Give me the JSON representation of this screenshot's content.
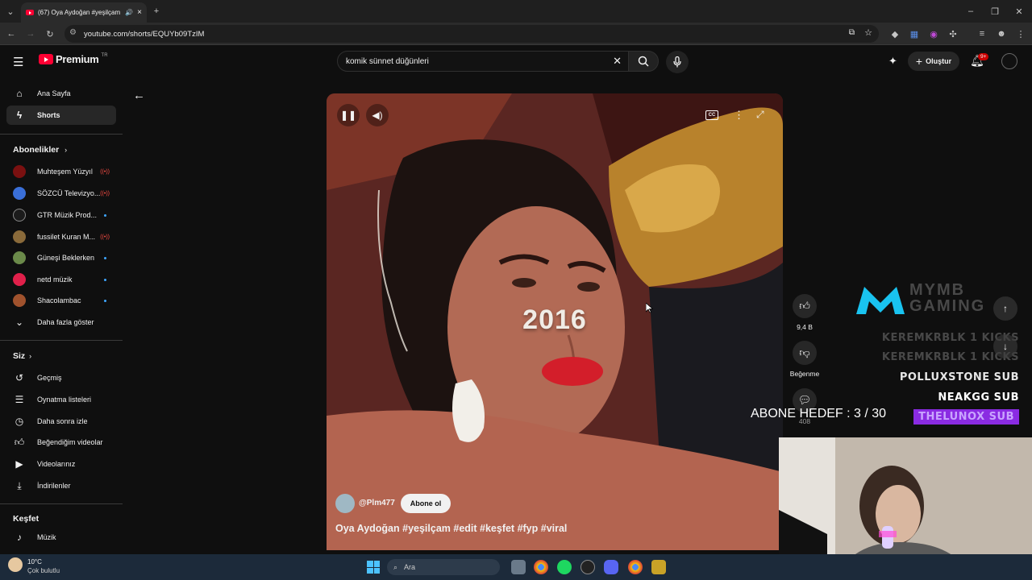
{
  "browser": {
    "tab_title": "(67) Oya Aydoğan #yeşilçam",
    "url": "youtube.com/shorts/EQUYb09TzIM"
  },
  "header": {
    "logo_text": "Premium",
    "region": "TR",
    "search_value": "komik sünnet düğünleri",
    "create_label": "Oluştur",
    "notif_count": "9+"
  },
  "sidebar": {
    "home": "Ana Sayfa",
    "shorts": "Shorts",
    "subs_title": "Abonelikler",
    "subscriptions": [
      {
        "name": "Muhteşem Yüzyıl",
        "live": true,
        "color": "#7a1010"
      },
      {
        "name": "SÖZCÜ Televizyo...",
        "live": true,
        "color": "#3a6fd8"
      },
      {
        "name": "GTR Müzik Prod...",
        "live": false,
        "color": "#1b1b1b"
      },
      {
        "name": "fussilet Kuran M...",
        "live": true,
        "color": "#8a6a3a"
      },
      {
        "name": "Güneşi Beklerken",
        "live": false,
        "color": "#6b8a4a"
      },
      {
        "name": "netd müzik",
        "live": false,
        "color": "#e0204a"
      },
      {
        "name": "Shacolambac",
        "live": false,
        "color": "#a0522d"
      }
    ],
    "show_more": "Daha fazla göster",
    "you_title": "Siz",
    "you_items": [
      "Geçmiş",
      "Oynatma listeleri",
      "Daha sonra izle",
      "Beğendiğim videolar",
      "Videolarınız",
      "İndirilenler"
    ],
    "explore_title": "Keşfet",
    "explore_items": [
      "Müzik"
    ]
  },
  "video": {
    "overlay_text": "2016",
    "channel": "@Plm477",
    "subscribe_label": "Abone ol",
    "caption": "Oya Aydoğan #yeşilçam #edit #keşfet #fyp #viral"
  },
  "actions": {
    "likes": "9,4 B",
    "dislike_label": "Beğenme",
    "comments": "408"
  },
  "stream_overlay": {
    "kicks": [
      "KEREMKRBLK 1 KICKS",
      "KEREMKRBLK 1 KICKS"
    ],
    "subs": [
      {
        "name": "POLLUXSTONE",
        "tag": "SUB"
      },
      {
        "name": "NEAKGG",
        "tag": "SUB"
      },
      {
        "name": "THELUNOX",
        "tag": "SUB"
      }
    ],
    "goal": "ABONE HEDEF : 3 / 30",
    "brand": "MYMB GAMING"
  },
  "taskbar": {
    "weather_temp": "10°C",
    "weather_desc": "Çok bulutlu",
    "search_label": "Ara"
  },
  "colors": {
    "accent_red": "#ff0033",
    "background": "#0f0f0f",
    "sub_highlight": "#8a2be2"
  }
}
